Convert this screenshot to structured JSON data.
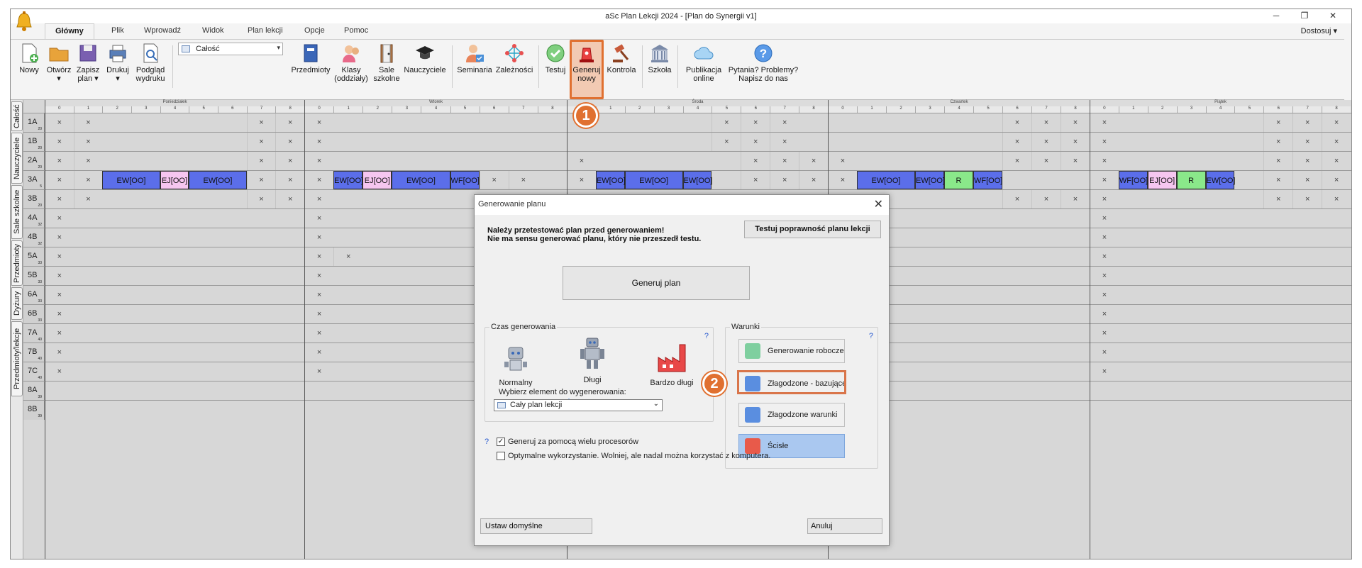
{
  "window": {
    "title": "aSc Plan Lekcji 2024  - [Plan do Synergii v1]",
    "minimize": "─",
    "restore": "❐",
    "close": "✕"
  },
  "tabs": [
    "Główny",
    "Plik",
    "Wprowadź",
    "Widok",
    "Plan lekcji",
    "Opcje",
    "Pomoc"
  ],
  "customize": "Dostosuj ▾",
  "ribbon": {
    "scope_value": "Całość",
    "buttons": [
      {
        "label": "Nowy"
      },
      {
        "label": "Otwórz\n▾"
      },
      {
        "label": "Zapisz\nplan ▾"
      },
      {
        "label": "Drukuj\n▾"
      },
      {
        "label": "Podgląd\nwydruku"
      },
      {
        "label": "Przedmioty"
      },
      {
        "label": "Klasy\n(oddziały)"
      },
      {
        "label": "Sale\nszkolne"
      },
      {
        "label": "Nauczyciele"
      },
      {
        "label": "Seminaria"
      },
      {
        "label": "Zależności"
      },
      {
        "label": "Testuj"
      },
      {
        "label": "Generuj\nnowy"
      },
      {
        "label": "Kontrola"
      },
      {
        "label": "Szkoła"
      },
      {
        "label": "Publikacja\nonline"
      },
      {
        "label": "Pytania? Problemy?\nNapisz do nas"
      }
    ]
  },
  "side_tabs": [
    "Całość",
    "Nauczyciele",
    "Sale szkolne",
    "Przedmioty",
    "Dyżury",
    "Przedmioty/lekcje"
  ],
  "days": [
    "Poniedziałek",
    "Wtorek",
    "Środa",
    "Czwartek",
    "Piątek"
  ],
  "periods": [
    "0",
    "1",
    "2",
    "3",
    "4",
    "5",
    "6",
    "7",
    "8"
  ],
  "classes": [
    {
      "name": "1A",
      "sub": "20"
    },
    {
      "name": "1B",
      "sub": "20"
    },
    {
      "name": "2A",
      "sub": "20"
    },
    {
      "name": "3A",
      "sub": "5"
    },
    {
      "name": "3B",
      "sub": "20"
    },
    {
      "name": "4A",
      "sub": "32"
    },
    {
      "name": "4B",
      "sub": "32"
    },
    {
      "name": "5A",
      "sub": "33"
    },
    {
      "name": "5B",
      "sub": "33"
    },
    {
      "name": "6A",
      "sub": "33"
    },
    {
      "name": "6B",
      "sub": "33"
    },
    {
      "name": "7A",
      "sub": "40"
    },
    {
      "name": "7B",
      "sub": "40"
    },
    {
      "name": "7C",
      "sub": "40"
    },
    {
      "name": "8A",
      "sub": "39"
    },
    {
      "name": "8B",
      "sub": "39"
    }
  ],
  "cross": "×",
  "lessons": {
    "ew": "EW[OO]",
    "ej": "EJ[OO]",
    "wf": "WF[OO]",
    "r": "R"
  },
  "markers": {
    "one": "1",
    "two": "2"
  },
  "dialog": {
    "title": "Generowanie planu",
    "close": "✕",
    "warning_line1": "Należy przetestować plan przed generowaniem!",
    "warning_line2": "Nie ma sensu generować planu, który nie przeszedł testu.",
    "test_button": "Testuj poprawność planu lekcji",
    "generate_button": "Generuj plan",
    "time_group": "Czas generowania",
    "help": "?",
    "time_options": [
      "Normalny",
      "Długi",
      "Bardzo długi"
    ],
    "time_level": "Długi",
    "conditions_group": "Warunki",
    "conditions": [
      "Generowanie robocze",
      "Złagodzone - bazujące na wa",
      "Złagodzone warunki",
      "Ścisłe"
    ],
    "select_label": "Wybierz element do wygenerowania:",
    "select_value": "Cały plan lekcji",
    "multi_cpu": "Generuj za pomocą wielu procesorów",
    "optimal_use": "Optymalne wykorzystanie. Wolniej, ale nadal można korzystać z komputera.",
    "reset_button": "Ustaw domyślne",
    "cancel_button": "Anuluj"
  },
  "colors": {
    "accent": "#e07030",
    "lesson_blue": "#5b6eea",
    "lesson_pink": "#f6c6f0",
    "lesson_green": "#8ae88a",
    "selected_condition": "#aac8f0"
  }
}
